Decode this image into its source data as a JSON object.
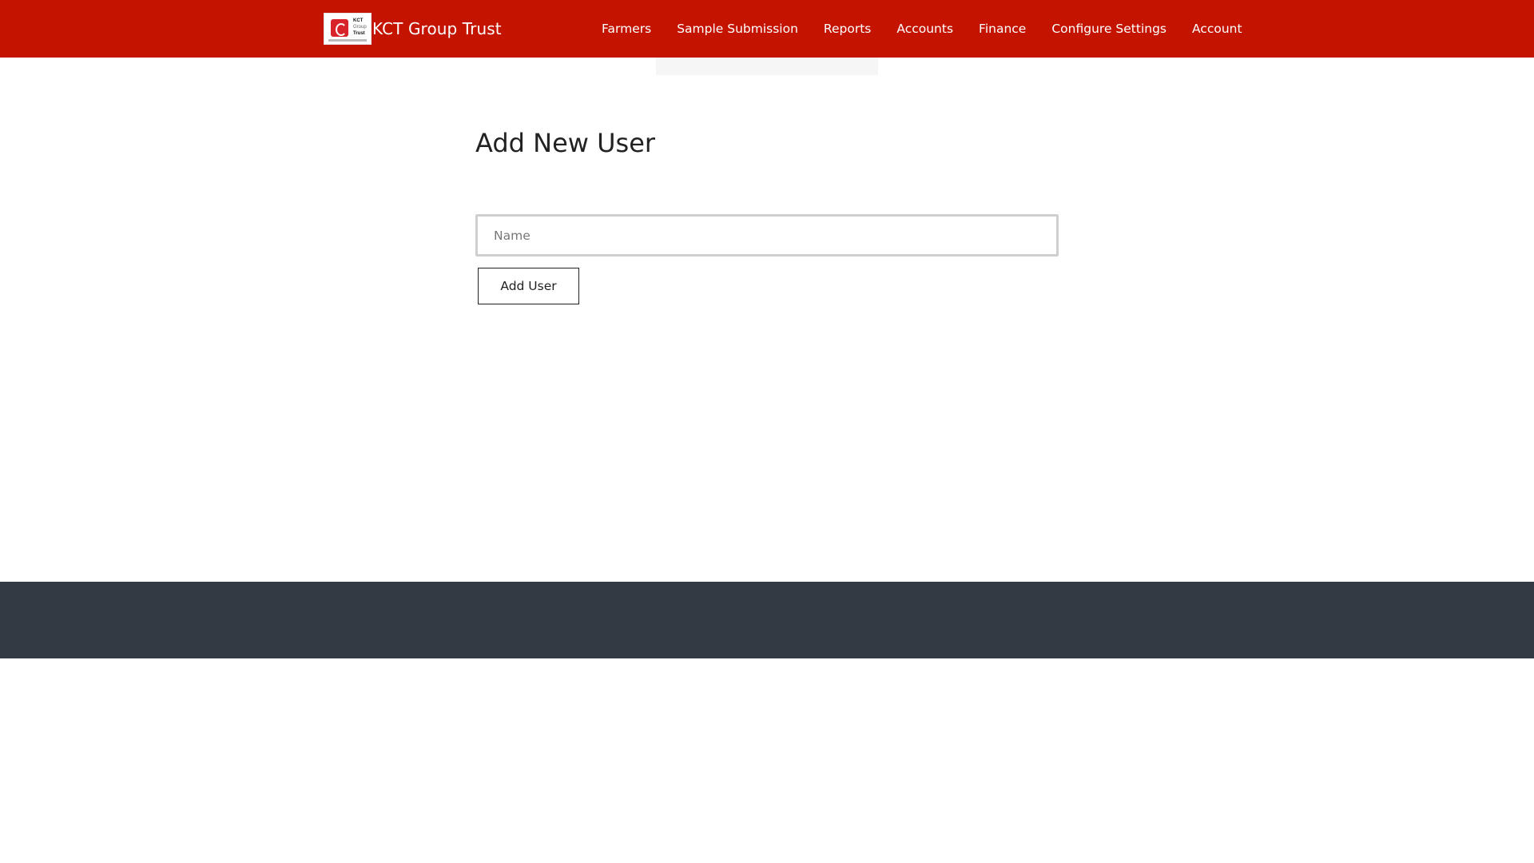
{
  "brand": {
    "name": "KCT Group Trust",
    "logo_lines": [
      "KCT",
      "Group",
      "Trust"
    ]
  },
  "nav": {
    "items": [
      {
        "label": "Farmers"
      },
      {
        "label": "Sample Submission"
      },
      {
        "label": "Reports"
      },
      {
        "label": "Accounts"
      },
      {
        "label": "Finance"
      },
      {
        "label": "Configure Settings"
      },
      {
        "label": "Account"
      }
    ]
  },
  "main": {
    "title": "Add New User",
    "name_input": {
      "value": "",
      "placeholder": "Name"
    },
    "submit_label": "Add User"
  },
  "colors": {
    "navbar": "#c41400",
    "footer": "#343a43",
    "background": "#ffffff"
  }
}
